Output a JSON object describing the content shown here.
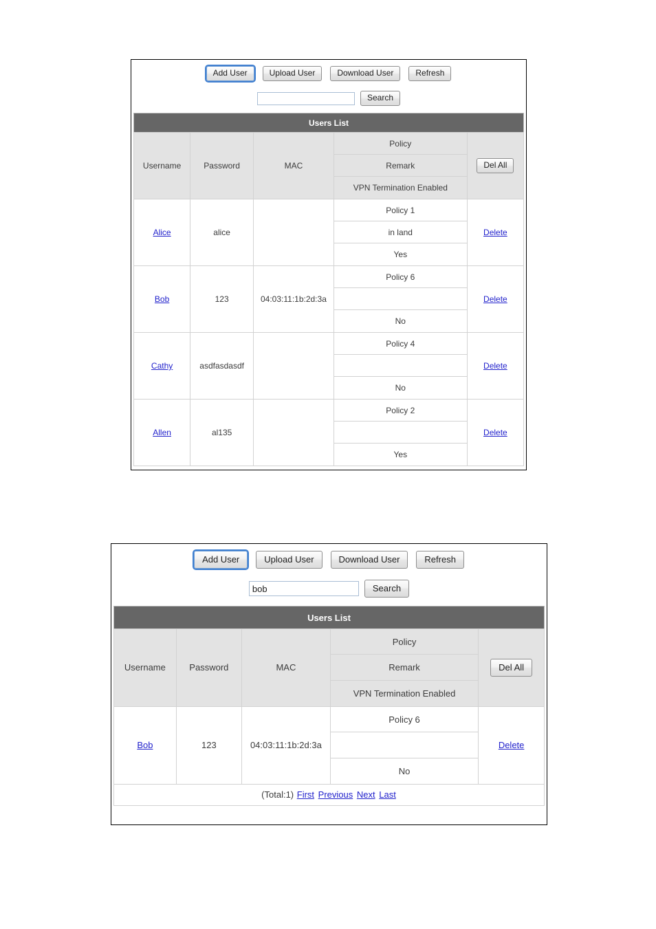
{
  "colors": {
    "list_header_bg": "#666666",
    "table_header_bg": "#e3e3e3",
    "link": "#2222cc",
    "grid_line": "#d2d2d2",
    "panel_border": "#000000"
  },
  "toolbar": {
    "add_user": "Add User",
    "upload_user": "Upload User",
    "download_user": "Download User",
    "refresh": "Refresh"
  },
  "search": {
    "button_label": "Search",
    "value_top": "",
    "value_bottom": "bob",
    "placeholder": ""
  },
  "list": {
    "title": "Users List",
    "del_all_label": "Del All",
    "delete_label": "Delete",
    "columns": {
      "username": "Username",
      "password": "Password",
      "mac": "MAC",
      "policy": "Policy",
      "remark": "Remark",
      "vpn": "VPN Termination Enabled"
    }
  },
  "panel_top": {
    "rows": [
      {
        "username": "Alice",
        "password": "alice",
        "mac": "",
        "policy": "Policy 1",
        "remark": "in land",
        "vpn": "Yes",
        "action": "Delete"
      },
      {
        "username": "Bob",
        "password": "123",
        "mac": "04:03:11:1b:2d:3a",
        "policy": "Policy 6",
        "remark": "",
        "vpn": "No",
        "action": "Delete"
      },
      {
        "username": "Cathy",
        "password": "asdfasdasdf",
        "mac": "",
        "policy": "Policy 4",
        "remark": "",
        "vpn": "No",
        "action": "Delete"
      },
      {
        "username": "Allen",
        "password": "al135",
        "mac": "",
        "policy": "Policy 2",
        "remark": "",
        "vpn": "Yes",
        "action": "Delete"
      }
    ]
  },
  "panel_bottom": {
    "rows": [
      {
        "username": "Bob",
        "password": "123",
        "mac": "04:03:11:1b:2d:3a",
        "policy": "Policy 6",
        "remark": "",
        "vpn": "No",
        "action": "Delete"
      }
    ],
    "pager": {
      "total": "(Total:1)",
      "first": "First",
      "previous": "Previous",
      "next": "Next",
      "last": "Last"
    }
  }
}
